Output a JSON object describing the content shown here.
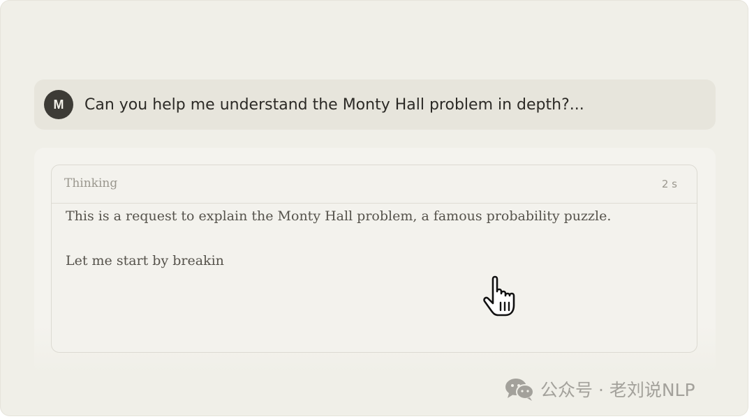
{
  "user_message": {
    "avatar_initial": "M",
    "text": "Can you help me understand the Monty Hall problem in depth?..."
  },
  "thinking": {
    "label": "Thinking",
    "duration": "2 s",
    "lines": [
      "This is a request to explain the Monty Hall problem, a famous probability puzzle.",
      "Let me start by breakin"
    ]
  },
  "cursor": {
    "icon": "hand-pointer-icon"
  },
  "watermark": {
    "icon": "wechat-icon",
    "text": "公众号 · 老刘说NLP"
  },
  "colors": {
    "background": "#f0efe8",
    "user_bubble": "#e7e5dc",
    "avatar": "#3d3b36",
    "thinking_card": "#f3f2ed",
    "muted_text": "#9a978e"
  }
}
